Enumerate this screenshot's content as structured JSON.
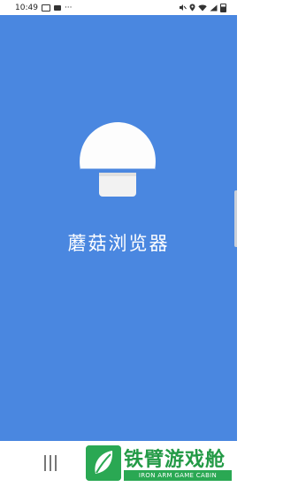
{
  "status_bar": {
    "time": "10:49",
    "overflow": "···",
    "icons": [
      "image-icon",
      "keyboard-icon",
      "mute-icon",
      "location-icon",
      "wifi-icon",
      "signal-icon",
      "battery-icon"
    ]
  },
  "splash": {
    "app_name": "蘑菇浏览器",
    "background_color": "#4a87e0",
    "logo_icon": "mushroom-icon"
  },
  "navigation_bar": {
    "recent_icon": "recent-apps-icon"
  },
  "watermark": {
    "name": "铁臂游戏舱",
    "subtitle": "IRON ARM GAME CABIN",
    "brand_color": "#2aa853"
  }
}
